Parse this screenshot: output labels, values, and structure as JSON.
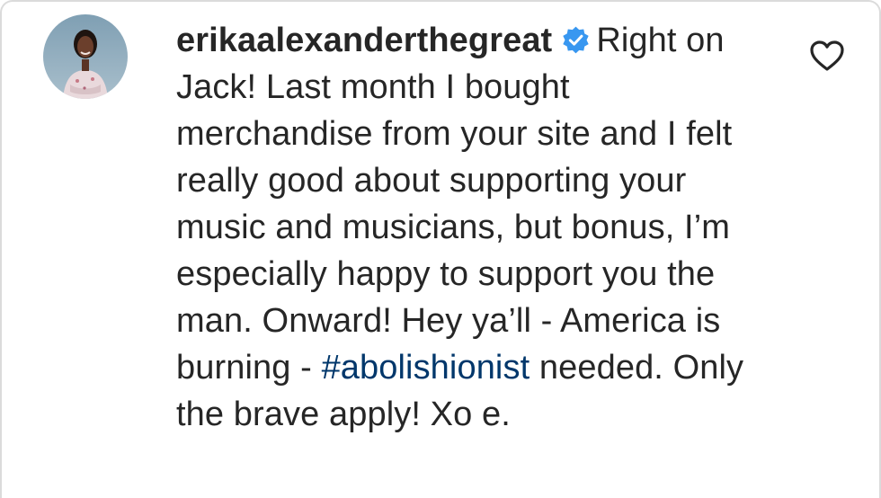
{
  "comment": {
    "username": "erikaalexanderthegreat",
    "text_part1": "Right on Jack! Last month I bought merchandise from your site and I felt really good about supporting your music and musicians, but bonus, I’m especially happy to support you the man. Onward! Hey ya’ll - America is burning -",
    "hashtag": "#abolishionist",
    "text_part2": "needed. Only the brave apply! Xo e."
  },
  "icons": {
    "verified": "verified-badge-icon",
    "like": "heart-icon"
  },
  "colors": {
    "text": "#262626",
    "hashtag": "#00376b",
    "verified_badge": "#3897f0",
    "border": "#dbdbdb"
  }
}
